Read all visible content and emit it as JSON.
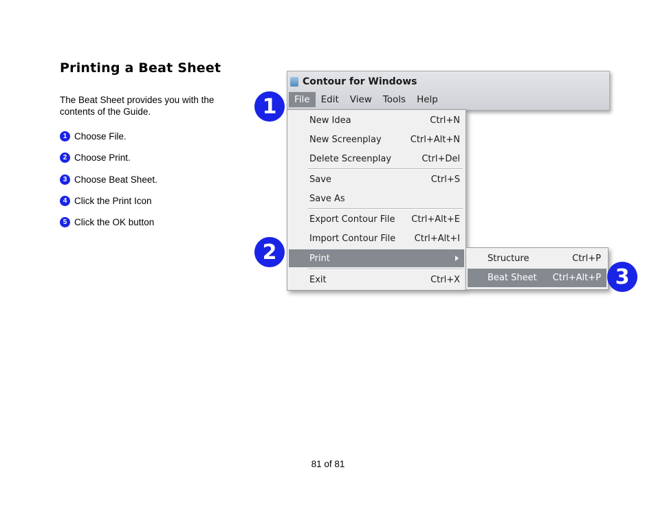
{
  "doc": {
    "title": "Printing a Beat Sheet",
    "intro": "The Beat Sheet provides you with the contents of the Guide.",
    "steps": [
      {
        "num": "1",
        "text": "Choose File."
      },
      {
        "num": "2",
        "text": "Choose Print."
      },
      {
        "num": "3",
        "text": "Choose Beat Sheet."
      },
      {
        "num": "4",
        "text": "Click the Print Icon"
      },
      {
        "num": "5",
        "text": "Click the OK button"
      }
    ],
    "footer": "81 of 81"
  },
  "app": {
    "title": "Contour for Windows",
    "menu": [
      "File",
      "Edit",
      "View",
      "Tools",
      "Help"
    ],
    "file_menu": [
      {
        "label": "New Idea",
        "shortcut": "Ctrl+N"
      },
      {
        "label": "New Screenplay",
        "shortcut": "Ctrl+Alt+N"
      },
      {
        "label": "Delete Screenplay",
        "shortcut": "Ctrl+Del"
      },
      {
        "label": "Save",
        "shortcut": "Ctrl+S"
      },
      {
        "label": "Save As",
        "shortcut": ""
      },
      {
        "label": "Export Contour File",
        "shortcut": "Ctrl+Alt+E"
      },
      {
        "label": "Import Contour File",
        "shortcut": "Ctrl+Alt+I"
      },
      {
        "label": "Print",
        "shortcut": ""
      },
      {
        "label": "Exit",
        "shortcut": "Ctrl+X"
      }
    ],
    "print_submenu": [
      {
        "label": "Structure",
        "shortcut": "Ctrl+P"
      },
      {
        "label": "Beat Sheet",
        "shortcut": "Ctrl+Alt+P"
      }
    ]
  },
  "callouts": [
    "1",
    "2",
    "3"
  ],
  "colors": {
    "callout": "#1a24e6",
    "highlight": "#858a90"
  }
}
